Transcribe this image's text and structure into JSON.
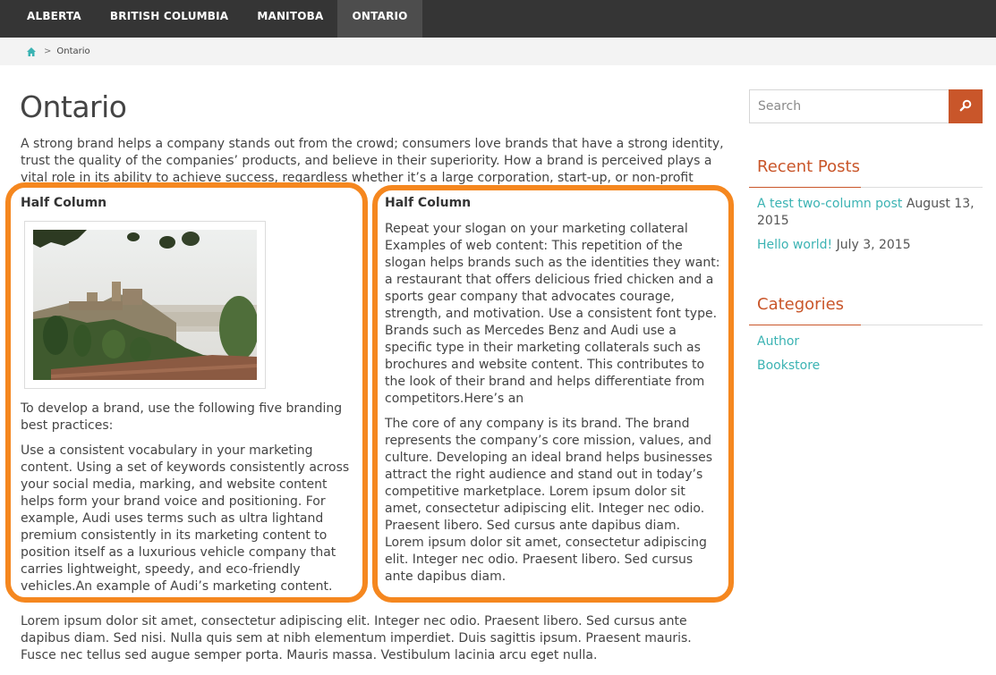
{
  "nav": {
    "items": [
      "ALBERTA",
      "BRITISH COLUMBIA",
      "MANITOBA",
      "ONTARIO"
    ],
    "active": "ONTARIO"
  },
  "breadcrumb": {
    "separator": ">",
    "current": "Ontario"
  },
  "page": {
    "title": "Ontario",
    "intro": "A strong brand helps a company stands out from the crowd; consumers love brands that have a strong identity, trust the quality of the companies’ products, and believe in their superiority. How a brand is perceived plays a vital role in its ability to achieve success, regardless whether it’s a large corporation, start-up, or non-profit organization.",
    "left_column": {
      "heading": "Half Column",
      "para1": "To develop a brand, use the following five branding best practices:",
      "para2": "Use a consistent vocabulary in your marketing content. Using a set of keywords consistently across your social media, marking, and website content helps form your brand voice and positioning. For example, Audi uses terms such as ultra lightand premium consistently in its marketing content to position itself as a luxurious vehicle company that carries lightweight, speedy, and eco-friendly vehicles.An example of Audi’s marketing content."
    },
    "right_column": {
      "heading": "Half Column",
      "para1": "Repeat your slogan on your marketing collateral Examples of web content: This repetition of the slogan helps brands such as the identities they want: a restaurant that offers delicious fried chicken and a sports gear company that advocates courage, strength, and motivation. Use a consistent font type. Brands such as Mercedes Benz and Audi use a specific type in their marketing collaterals such as brochures and website content. This contributes to the look of their brand and helps differentiate from competitors.Here’s an",
      "para2": "The core of any company is its brand. The brand represents the company’s core mission, values, and culture. Developing an ideal brand helps businesses attract the right audience and stand out in today’s competitive marketplace. Lorem ipsum dolor sit amet, consectetur adipiscing elit. Integer nec odio. Praesent libero. Sed cursus ante dapibus diam. Lorem ipsum dolor sit amet, consectetur adipiscing elit. Integer nec odio. Praesent libero. Sed cursus ante dapibus diam."
    },
    "outro": "Lorem ipsum dolor sit amet, consectetur adipiscing elit. Integer nec odio. Praesent libero. Sed cursus ante dapibus diam. Sed nisi. Nulla quis sem at nibh elementum imperdiet. Duis sagittis ipsum. Praesent mauris. Fusce nec tellus sed augue semper porta. Mauris massa. Vestibulum lacinia arcu eget nulla."
  },
  "sidebar": {
    "search": {
      "placeholder": "Search",
      "icon": "search-icon"
    },
    "recent_posts": {
      "title": "Recent Posts",
      "items": [
        {
          "title": "A test two-column post",
          "date": "August 13, 2015"
        },
        {
          "title": "Hello world!",
          "date": "July 3, 2015"
        }
      ]
    },
    "categories": {
      "title": "Categories",
      "items": [
        "Author",
        "Bookstore"
      ]
    }
  },
  "colors": {
    "nav_bg": "#353535",
    "accent": "#c9562a",
    "link": "#3bb3b3",
    "highlight": "#f5871f"
  }
}
